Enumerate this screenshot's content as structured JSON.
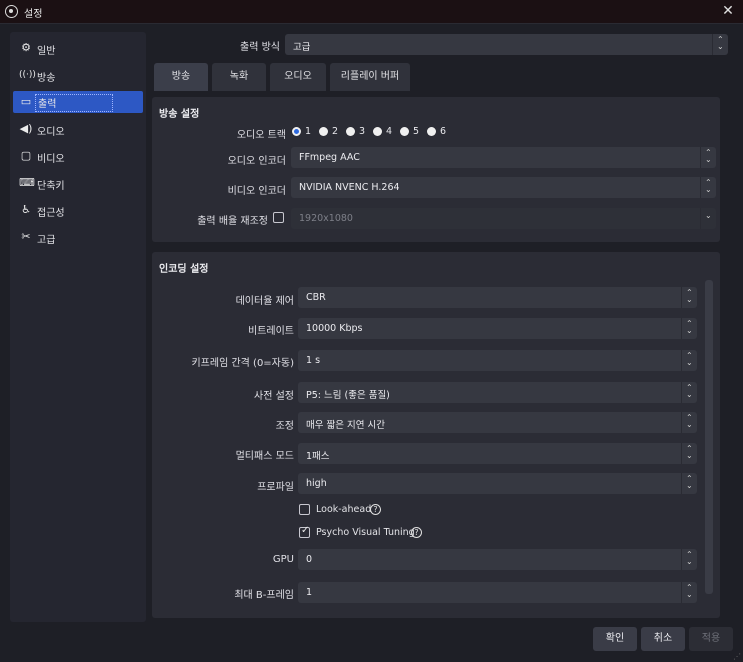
{
  "window": {
    "title": "설정"
  },
  "sidebar": {
    "items": [
      {
        "label": "일반",
        "icon": "gear-icon"
      },
      {
        "label": "방송",
        "icon": "broadcast-icon"
      },
      {
        "label": "출력",
        "icon": "output-icon"
      },
      {
        "label": "오디오",
        "icon": "speaker-icon"
      },
      {
        "label": "비디오",
        "icon": "monitor-icon"
      },
      {
        "label": "단축키",
        "icon": "keyboard-icon"
      },
      {
        "label": "접근성",
        "icon": "accessibility-icon"
      },
      {
        "label": "고급",
        "icon": "tools-icon"
      }
    ],
    "active_index": 2
  },
  "output_mode": {
    "label": "출력 방식",
    "value": "고급"
  },
  "tabs": [
    {
      "label": "방송",
      "active": true
    },
    {
      "label": "녹화",
      "active": false
    },
    {
      "label": "오디오",
      "active": false
    },
    {
      "label": "리플레이 버퍼",
      "active": false
    }
  ],
  "broadcast_settings": {
    "title": "방송 설정",
    "audio_track": {
      "label": "오디오 트랙",
      "options": [
        "1",
        "2",
        "3",
        "4",
        "5",
        "6"
      ],
      "selected": "1"
    },
    "audio_encoder": {
      "label": "오디오 인코더",
      "value": "FFmpeg AAC"
    },
    "video_encoder": {
      "label": "비디오 인코더",
      "value": "NVIDIA NVENC H.264"
    },
    "rescale": {
      "label": "출력 배율 재조정",
      "checked": false,
      "value": "1920x1080"
    }
  },
  "encoding_settings": {
    "title": "인코딩 설정",
    "rate_control": {
      "label": "데이터율 제어",
      "value": "CBR"
    },
    "bitrate": {
      "label": "비트레이트",
      "value": "10000 Kbps"
    },
    "keyframe": {
      "label": "키프레임 간격 (0=자동)",
      "value": "1 s"
    },
    "preset": {
      "label": "사전 설정",
      "value": "P5: 느림 (좋은 품질)"
    },
    "tuning": {
      "label": "조정",
      "value": "매우 짧은 지연 시간"
    },
    "multipass": {
      "label": "멀티패스 모드",
      "value": "1패스"
    },
    "profile": {
      "label": "프로파일",
      "value": "high"
    },
    "lookahead": {
      "label": "Look-ahead",
      "checked": false
    },
    "psycho_visual": {
      "label": "Psycho Visual Tuning",
      "checked": true
    },
    "gpu": {
      "label": "GPU",
      "value": "0"
    },
    "max_bframes": {
      "label": "최대 B-프레임",
      "value": "1"
    }
  },
  "buttons": {
    "ok": "확인",
    "cancel": "취소",
    "apply": "적용"
  },
  "help_glyph": "?"
}
